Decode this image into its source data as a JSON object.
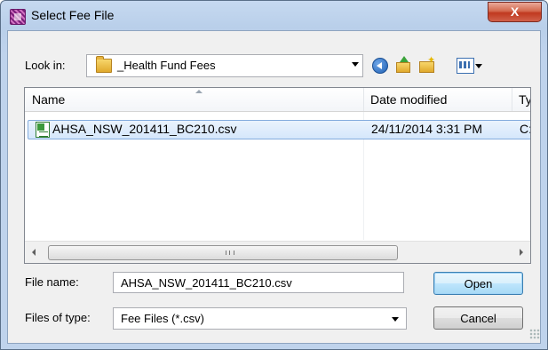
{
  "window": {
    "title": "Select Fee File",
    "close_label": "X"
  },
  "toolbar": {
    "look_in_label": "Look in:",
    "look_in_value": "_Health Fund Fees",
    "icons": [
      "back-icon",
      "up-folder-icon",
      "new-folder-icon",
      "views-menu-icon"
    ]
  },
  "list": {
    "columns": [
      "Name",
      "Date modified",
      "Ty"
    ],
    "rows": [
      {
        "name": "AHSA_NSW_201411_BC210.csv",
        "date": "24/11/2014 3:31 PM",
        "type": "C:"
      }
    ],
    "scroll_grip": "III"
  },
  "form": {
    "file_name_label": "File name:",
    "file_name_value": "AHSA_NSW_201411_BC210.csv",
    "file_type_label": "Files of type:",
    "file_type_value": "Fee Files (*.csv)"
  },
  "buttons": {
    "open": "Open",
    "cancel": "Cancel"
  },
  "colors": {
    "title_bar": "#c6d9f0",
    "close_button": "#c0391f",
    "selection": "#d5e7fb",
    "default_button_border": "#3c7fb1"
  }
}
